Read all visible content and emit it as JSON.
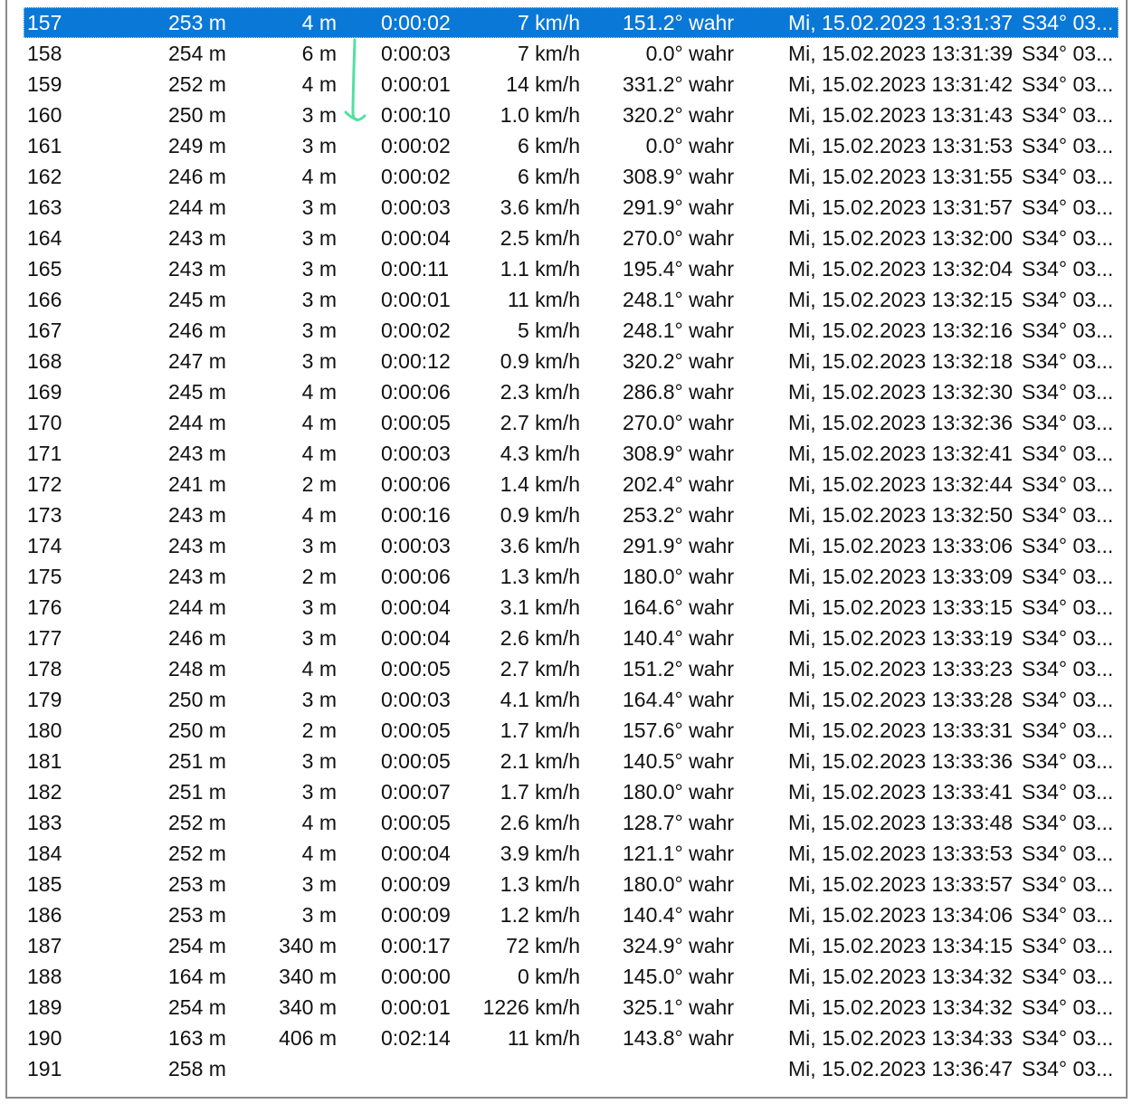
{
  "list": {
    "rows": [
      {
        "id": "157",
        "alt": "253 m",
        "dist": "4 m",
        "dur": "0:00:02",
        "speed": "7 km/h",
        "course": "151.2° wahr",
        "time": "Mi, 15.02.2023 13:31:37",
        "pos": "S34° 03...",
        "selected": true
      },
      {
        "id": "158",
        "alt": "254 m",
        "dist": "6 m",
        "dur": "0:00:03",
        "speed": "7 km/h",
        "course": "0.0° wahr",
        "time": "Mi, 15.02.2023 13:31:39",
        "pos": "S34° 03..."
      },
      {
        "id": "159",
        "alt": "252 m",
        "dist": "4 m",
        "dur": "0:00:01",
        "speed": "14 km/h",
        "course": "331.2° wahr",
        "time": "Mi, 15.02.2023 13:31:42",
        "pos": "S34° 03..."
      },
      {
        "id": "160",
        "alt": "250 m",
        "dist": "3 m",
        "dur": "0:00:10",
        "speed": "1.0 km/h",
        "course": "320.2° wahr",
        "time": "Mi, 15.02.2023 13:31:43",
        "pos": "S34° 03..."
      },
      {
        "id": "161",
        "alt": "249 m",
        "dist": "3 m",
        "dur": "0:00:02",
        "speed": "6 km/h",
        "course": "0.0° wahr",
        "time": "Mi, 15.02.2023 13:31:53",
        "pos": "S34° 03..."
      },
      {
        "id": "162",
        "alt": "246 m",
        "dist": "4 m",
        "dur": "0:00:02",
        "speed": "6 km/h",
        "course": "308.9° wahr",
        "time": "Mi, 15.02.2023 13:31:55",
        "pos": "S34° 03..."
      },
      {
        "id": "163",
        "alt": "244 m",
        "dist": "3 m",
        "dur": "0:00:03",
        "speed": "3.6 km/h",
        "course": "291.9° wahr",
        "time": "Mi, 15.02.2023 13:31:57",
        "pos": "S34° 03..."
      },
      {
        "id": "164",
        "alt": "243 m",
        "dist": "3 m",
        "dur": "0:00:04",
        "speed": "2.5 km/h",
        "course": "270.0° wahr",
        "time": "Mi, 15.02.2023 13:32:00",
        "pos": "S34° 03..."
      },
      {
        "id": "165",
        "alt": "243 m",
        "dist": "3 m",
        "dur": "0:00:11",
        "speed": "1.1 km/h",
        "course": "195.4° wahr",
        "time": "Mi, 15.02.2023 13:32:04",
        "pos": "S34° 03..."
      },
      {
        "id": "166",
        "alt": "245 m",
        "dist": "3 m",
        "dur": "0:00:01",
        "speed": "11 km/h",
        "course": "248.1° wahr",
        "time": "Mi, 15.02.2023 13:32:15",
        "pos": "S34° 03..."
      },
      {
        "id": "167",
        "alt": "246 m",
        "dist": "3 m",
        "dur": "0:00:02",
        "speed": "5 km/h",
        "course": "248.1° wahr",
        "time": "Mi, 15.02.2023 13:32:16",
        "pos": "S34° 03..."
      },
      {
        "id": "168",
        "alt": "247 m",
        "dist": "3 m",
        "dur": "0:00:12",
        "speed": "0.9 km/h",
        "course": "320.2° wahr",
        "time": "Mi, 15.02.2023 13:32:18",
        "pos": "S34° 03..."
      },
      {
        "id": "169",
        "alt": "245 m",
        "dist": "4 m",
        "dur": "0:00:06",
        "speed": "2.3 km/h",
        "course": "286.8° wahr",
        "time": "Mi, 15.02.2023 13:32:30",
        "pos": "S34° 03..."
      },
      {
        "id": "170",
        "alt": "244 m",
        "dist": "4 m",
        "dur": "0:00:05",
        "speed": "2.7 km/h",
        "course": "270.0° wahr",
        "time": "Mi, 15.02.2023 13:32:36",
        "pos": "S34° 03..."
      },
      {
        "id": "171",
        "alt": "243 m",
        "dist": "4 m",
        "dur": "0:00:03",
        "speed": "4.3 km/h",
        "course": "308.9° wahr",
        "time": "Mi, 15.02.2023 13:32:41",
        "pos": "S34° 03..."
      },
      {
        "id": "172",
        "alt": "241 m",
        "dist": "2 m",
        "dur": "0:00:06",
        "speed": "1.4 km/h",
        "course": "202.4° wahr",
        "time": "Mi, 15.02.2023 13:32:44",
        "pos": "S34° 03..."
      },
      {
        "id": "173",
        "alt": "243 m",
        "dist": "4 m",
        "dur": "0:00:16",
        "speed": "0.9 km/h",
        "course": "253.2° wahr",
        "time": "Mi, 15.02.2023 13:32:50",
        "pos": "S34° 03..."
      },
      {
        "id": "174",
        "alt": "243 m",
        "dist": "3 m",
        "dur": "0:00:03",
        "speed": "3.6 km/h",
        "course": "291.9° wahr",
        "time": "Mi, 15.02.2023 13:33:06",
        "pos": "S34° 03..."
      },
      {
        "id": "175",
        "alt": "243 m",
        "dist": "2 m",
        "dur": "0:00:06",
        "speed": "1.3 km/h",
        "course": "180.0° wahr",
        "time": "Mi, 15.02.2023 13:33:09",
        "pos": "S34° 03..."
      },
      {
        "id": "176",
        "alt": "244 m",
        "dist": "3 m",
        "dur": "0:00:04",
        "speed": "3.1 km/h",
        "course": "164.6° wahr",
        "time": "Mi, 15.02.2023 13:33:15",
        "pos": "S34° 03..."
      },
      {
        "id": "177",
        "alt": "246 m",
        "dist": "3 m",
        "dur": "0:00:04",
        "speed": "2.6 km/h",
        "course": "140.4° wahr",
        "time": "Mi, 15.02.2023 13:33:19",
        "pos": "S34° 03..."
      },
      {
        "id": "178",
        "alt": "248 m",
        "dist": "4 m",
        "dur": "0:00:05",
        "speed": "2.7 km/h",
        "course": "151.2° wahr",
        "time": "Mi, 15.02.2023 13:33:23",
        "pos": "S34° 03..."
      },
      {
        "id": "179",
        "alt": "250 m",
        "dist": "3 m",
        "dur": "0:00:03",
        "speed": "4.1 km/h",
        "course": "164.4° wahr",
        "time": "Mi, 15.02.2023 13:33:28",
        "pos": "S34° 03..."
      },
      {
        "id": "180",
        "alt": "250 m",
        "dist": "2 m",
        "dur": "0:00:05",
        "speed": "1.7 km/h",
        "course": "157.6° wahr",
        "time": "Mi, 15.02.2023 13:33:31",
        "pos": "S34° 03..."
      },
      {
        "id": "181",
        "alt": "251 m",
        "dist": "3 m",
        "dur": "0:00:05",
        "speed": "2.1 km/h",
        "course": "140.5° wahr",
        "time": "Mi, 15.02.2023 13:33:36",
        "pos": "S34° 03..."
      },
      {
        "id": "182",
        "alt": "251 m",
        "dist": "3 m",
        "dur": "0:00:07",
        "speed": "1.7 km/h",
        "course": "180.0° wahr",
        "time": "Mi, 15.02.2023 13:33:41",
        "pos": "S34° 03..."
      },
      {
        "id": "183",
        "alt": "252 m",
        "dist": "4 m",
        "dur": "0:00:05",
        "speed": "2.6 km/h",
        "course": "128.7° wahr",
        "time": "Mi, 15.02.2023 13:33:48",
        "pos": "S34° 03..."
      },
      {
        "id": "184",
        "alt": "252 m",
        "dist": "4 m",
        "dur": "0:00:04",
        "speed": "3.9 km/h",
        "course": "121.1° wahr",
        "time": "Mi, 15.02.2023 13:33:53",
        "pos": "S34° 03..."
      },
      {
        "id": "185",
        "alt": "253 m",
        "dist": "3 m",
        "dur": "0:00:09",
        "speed": "1.3 km/h",
        "course": "180.0° wahr",
        "time": "Mi, 15.02.2023 13:33:57",
        "pos": "S34° 03..."
      },
      {
        "id": "186",
        "alt": "253 m",
        "dist": "3 m",
        "dur": "0:00:09",
        "speed": "1.2 km/h",
        "course": "140.4° wahr",
        "time": "Mi, 15.02.2023 13:34:06",
        "pos": "S34° 03..."
      },
      {
        "id": "187",
        "alt": "254 m",
        "dist": "340 m",
        "dur": "0:00:17",
        "speed": "72 km/h",
        "course": "324.9° wahr",
        "time": "Mi, 15.02.2023 13:34:15",
        "pos": "S34° 03..."
      },
      {
        "id": "188",
        "alt": "164 m",
        "dist": "340 m",
        "dur": "0:00:00",
        "speed": "0 km/h",
        "course": "145.0° wahr",
        "time": "Mi, 15.02.2023 13:34:32",
        "pos": "S34° 03..."
      },
      {
        "id": "189",
        "alt": "254 m",
        "dist": "340 m",
        "dur": "0:00:01",
        "speed": "1226 km/h",
        "course": "325.1° wahr",
        "time": "Mi, 15.02.2023 13:34:32",
        "pos": "S34° 03..."
      },
      {
        "id": "190",
        "alt": "163 m",
        "dist": "406 m",
        "dur": "0:02:14",
        "speed": "11 km/h",
        "course": "143.8° wahr",
        "time": "Mi, 15.02.2023 13:34:33",
        "pos": "S34° 03..."
      },
      {
        "id": "191",
        "alt": "258 m",
        "dist": "",
        "dur": "",
        "speed": "",
        "course": "",
        "time": "Mi, 15.02.2023 13:36:47",
        "pos": "S34° 03..."
      }
    ]
  },
  "colors": {
    "selection": "#0a78d7",
    "annotation": "#52e0a0",
    "border": "#8a8a8a"
  }
}
